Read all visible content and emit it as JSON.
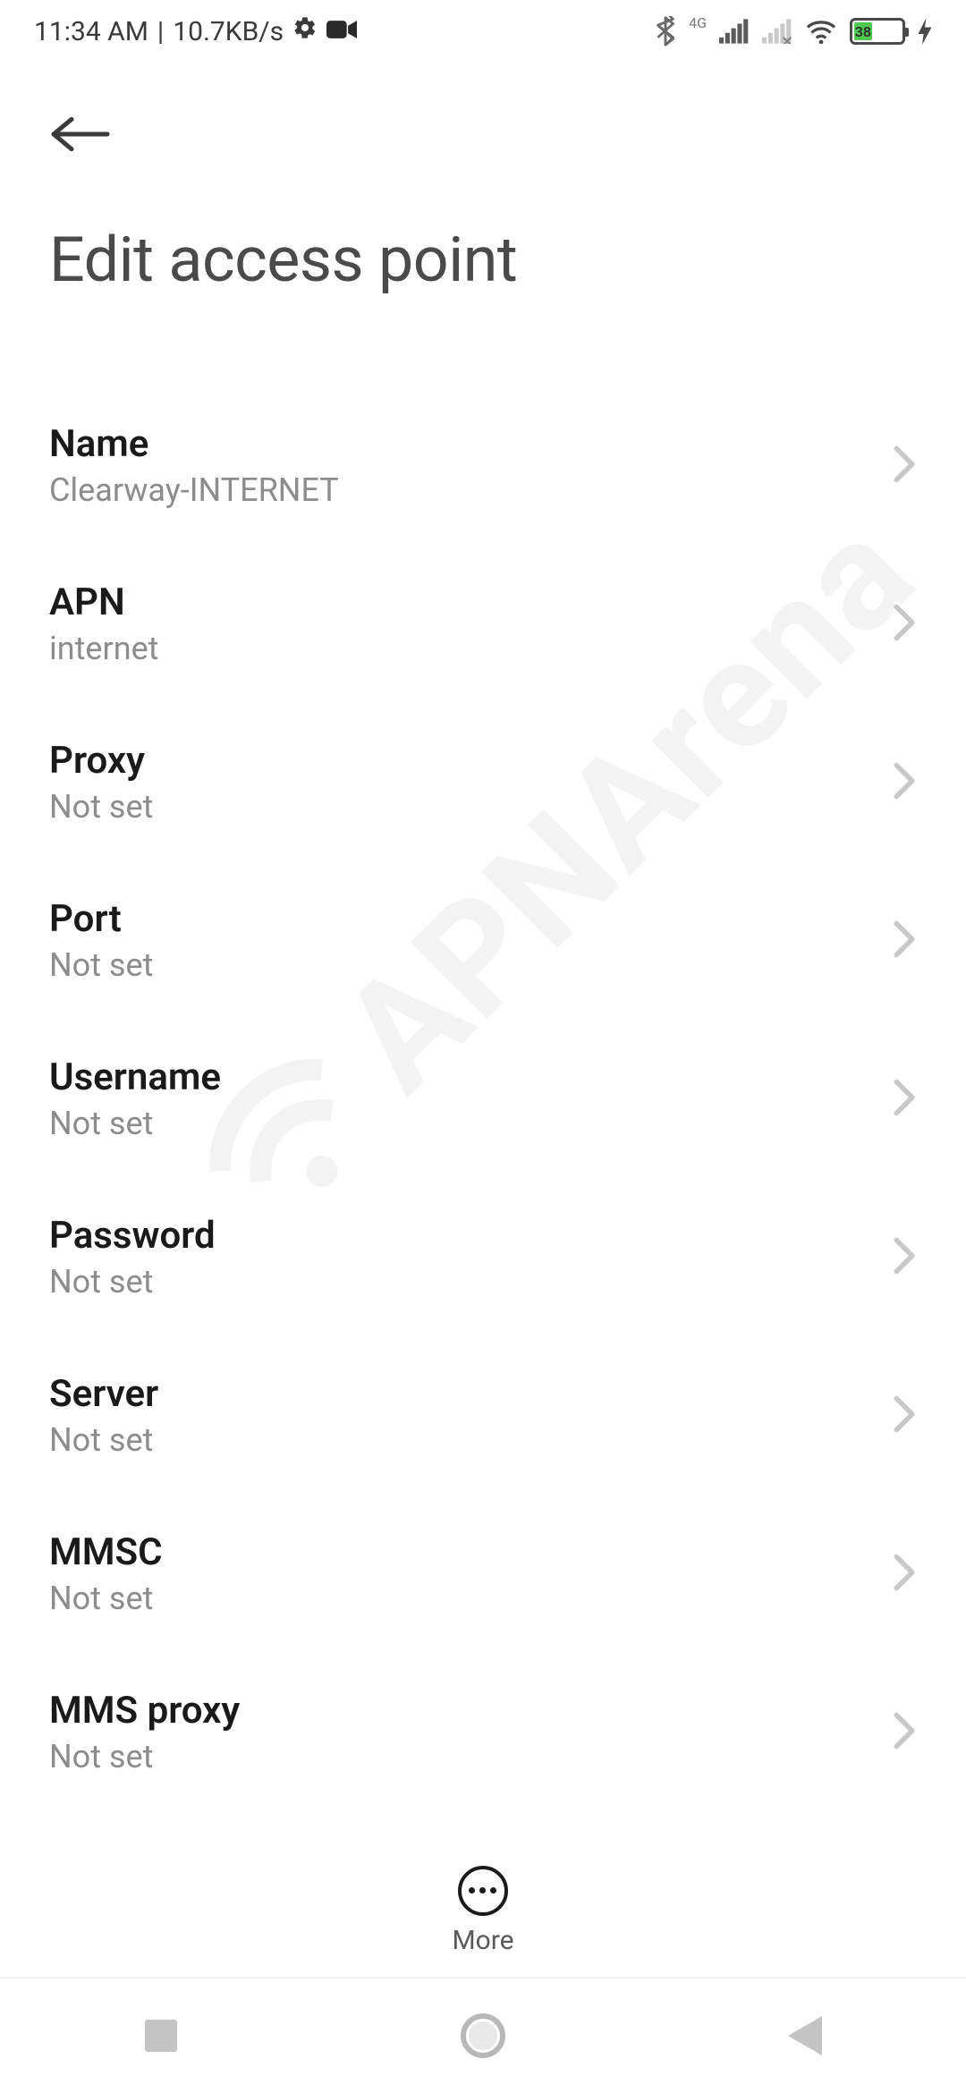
{
  "status_bar": {
    "time": "11:34 AM",
    "data_speed": "10.7KB/s",
    "network_label": "4G",
    "battery_percent": "38"
  },
  "header": {
    "title": "Edit access point"
  },
  "settings": [
    {
      "label": "Name",
      "value": "Clearway-INTERNET"
    },
    {
      "label": "APN",
      "value": "internet"
    },
    {
      "label": "Proxy",
      "value": "Not set"
    },
    {
      "label": "Port",
      "value": "Not set"
    },
    {
      "label": "Username",
      "value": "Not set"
    },
    {
      "label": "Password",
      "value": "Not set"
    },
    {
      "label": "Server",
      "value": "Not set"
    },
    {
      "label": "MMSC",
      "value": "Not set"
    },
    {
      "label": "MMS proxy",
      "value": "Not set"
    }
  ],
  "toolbar": {
    "more_label": "More"
  },
  "watermark": "APNArena"
}
